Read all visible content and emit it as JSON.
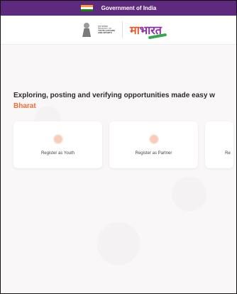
{
  "topbar": {
    "title": "Government of India",
    "flag_colors": [
      "#ff9933",
      "#ffffff",
      "#138808"
    ]
  },
  "header": {
    "ministry_lines": [
      "युवा कार्यक्रम",
      "MINISTRY OF",
      "YOUTH AFFAIRS",
      "AND SPORTS"
    ],
    "brand_main": "मा",
    "brand_accent": "भारत"
  },
  "hero": {
    "headline": "Exploring, posting and verifying opportunities made easy w",
    "subheadline": "Bharat"
  },
  "cards": [
    {
      "label": "Register as Youth",
      "icon": "youth-icon"
    },
    {
      "label": "Register as Partner",
      "icon": "partner-icon"
    },
    {
      "label": "Re",
      "icon": "register-icon"
    }
  ],
  "colors": {
    "topbar": "#5e2a7e",
    "accent_orange": "#ef6c32",
    "brand_purple": "#8b2fa8"
  }
}
